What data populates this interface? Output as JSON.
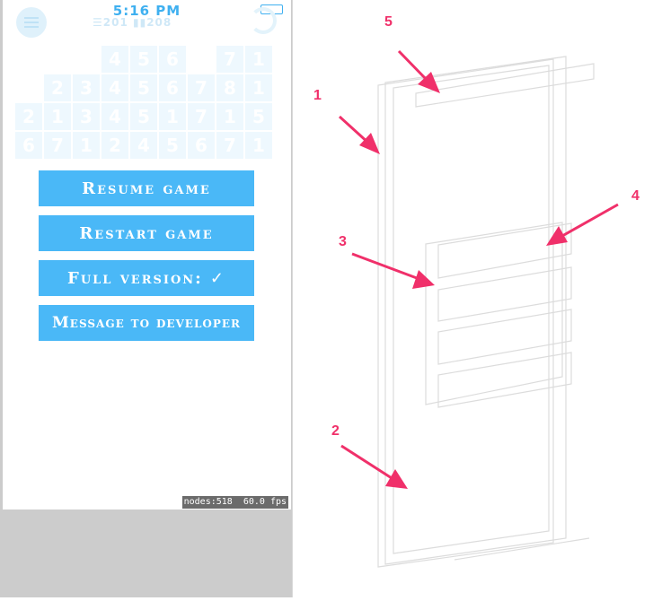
{
  "status_bar": {
    "time": "5:16 PM"
  },
  "top_bar": {
    "stats_text": "☰201 ▮▮208"
  },
  "grid": {
    "rows": [
      [
        "",
        "",
        "",
        "4",
        "5",
        "6",
        "",
        "7",
        "1"
      ],
      [
        "",
        "2",
        "3",
        "4",
        "5",
        "6",
        "7",
        "8",
        "1"
      ],
      [
        "2",
        "1",
        "3",
        "4",
        "5",
        "1",
        "7",
        "1",
        "5"
      ],
      [
        "6",
        "7",
        "1",
        "2",
        "4",
        "5",
        "6",
        "7",
        "1"
      ]
    ]
  },
  "menu": {
    "resume_label": "Resume game",
    "restart_label": "Restart game",
    "full_version_label": "Full version:",
    "full_version_check": "✓",
    "message_label": "Message to developer"
  },
  "debug": {
    "stats": "nodes:518  60.0 fps"
  },
  "diagram": {
    "labels": [
      "1",
      "2",
      "3",
      "4",
      "5"
    ],
    "arrow_color": "#f0306a",
    "outline_color": "#d9d9d9"
  }
}
